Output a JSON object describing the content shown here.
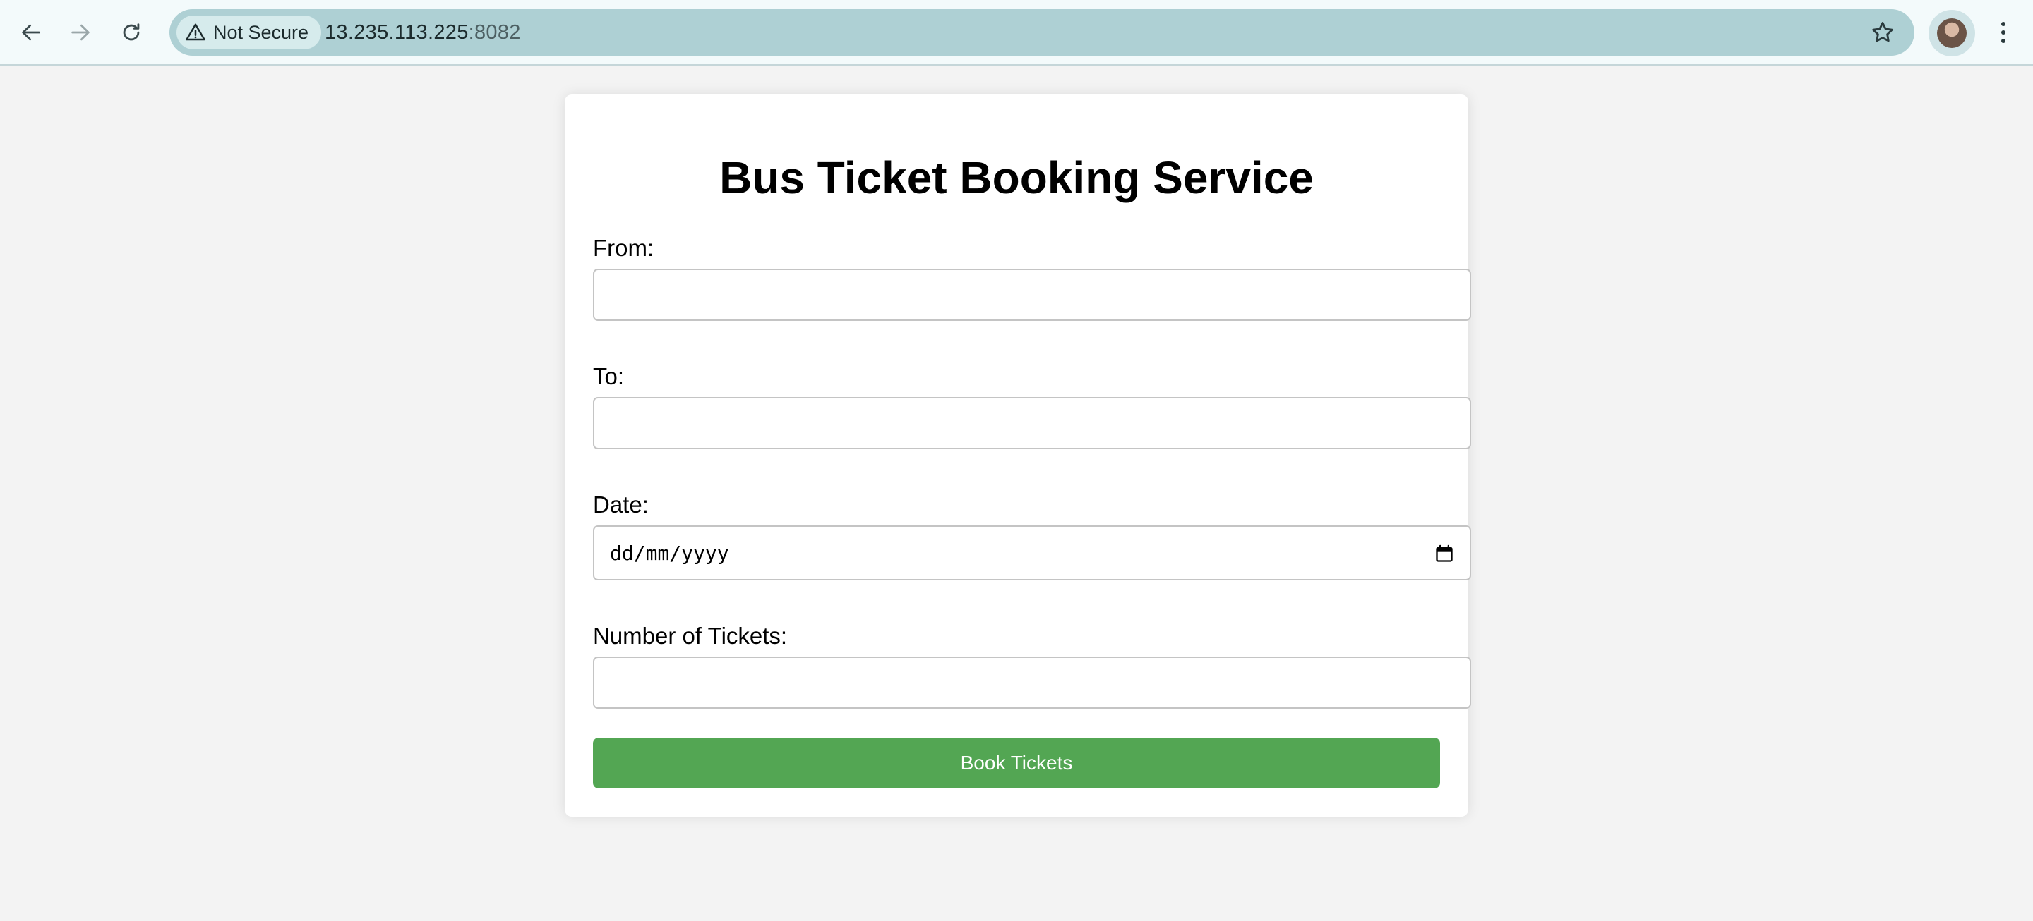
{
  "browser": {
    "security_label": "Not Secure",
    "url_host": "13.235.113.225",
    "url_port": ":8082"
  },
  "form": {
    "title": "Bus Ticket Booking Service",
    "from_label": "From:",
    "from_value": "",
    "to_label": "To:",
    "to_value": "",
    "date_label": "Date:",
    "date_placeholder": "dd/mm/yyyy",
    "tickets_label": "Number of Tickets:",
    "tickets_value": "",
    "submit_label": "Book Tickets"
  },
  "colors": {
    "page_background": "#f3f3f3",
    "card_background": "#ffffff",
    "button_green": "#53a653",
    "omnibox": "#aed0d4"
  },
  "icons": {
    "back": "arrow-left-icon",
    "forward": "arrow-right-icon",
    "reload": "reload-icon",
    "security": "warning-triangle-icon",
    "bookmark": "star-icon",
    "profile": "avatar",
    "menu": "kebab-menu-icon",
    "date_picker": "calendar-icon"
  }
}
